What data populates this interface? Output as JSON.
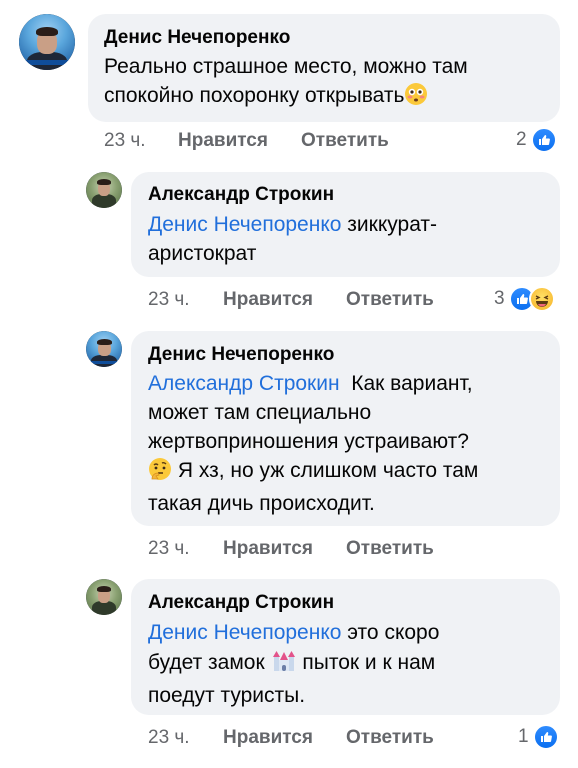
{
  "comments": [
    {
      "author": "Денис Нечепоренко",
      "mention": "",
      "lines": [
        "Реально страшное место, можно там",
        "спокойно похоронку открывать"
      ],
      "time": "23 ч.",
      "like_label": "Нравится",
      "reply_label": "Ответить",
      "reaction_count": "2",
      "reactions": [
        "like-icon"
      ]
    },
    {
      "author": "Александр Строкин",
      "mention": "Денис Нечепоренко",
      "lines": [
        " зиккурат-",
        "аристократ"
      ],
      "time": "23 ч.",
      "like_label": "Нравится",
      "reply_label": "Ответить",
      "reaction_count": "3",
      "reactions": [
        "like-icon",
        "haha-icon"
      ]
    },
    {
      "author": "Денис Нечепоренко",
      "mention": "Александр Строкин",
      "lines": [
        "  Как вариант,",
        "может там специально",
        "жертвоприношения устраивают?",
        " Я хз, но уж слишком часто там",
        "такая дичь происходит."
      ],
      "time": "23 ч.",
      "like_label": "Нравится",
      "reply_label": "Ответить",
      "reaction_count": "",
      "reactions": []
    },
    {
      "author": "Александр Строкин",
      "mention": "Денис Нечепоренко",
      "lines": [
        " это скоро",
        "будет замок ",
        " пыток и к нам",
        "поедут туристы."
      ],
      "time": "23 ч.",
      "like_label": "Нравится",
      "reply_label": "Ответить",
      "reaction_count": "1",
      "reactions": [
        "like-icon"
      ]
    }
  ],
  "colors": {
    "bubble": "#f0f2f5",
    "mention": "#216fdb",
    "meta": "#65676b",
    "like": "#0b6ff0"
  }
}
